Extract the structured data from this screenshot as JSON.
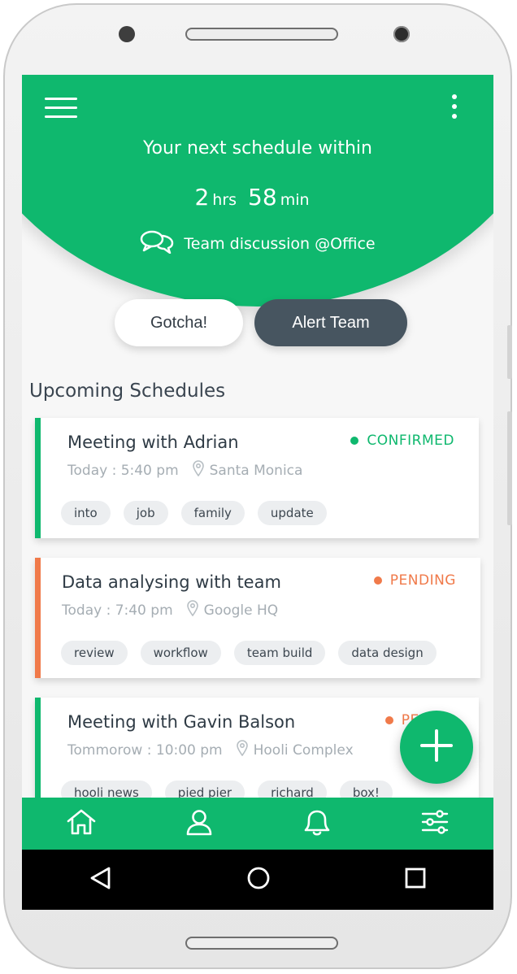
{
  "colors": {
    "accent": "#0fb86e",
    "pending": "#f07a4a",
    "dark_button": "#475560"
  },
  "header": {
    "title": "Your next schedule within",
    "hours_value": "2",
    "hours_unit": "hrs",
    "minutes_value": "58",
    "minutes_unit": "min",
    "event_text": "Team discussion @Office",
    "event_icon": "chat-bubbles-icon",
    "menu_icon": "hamburger-menu-icon",
    "more_icon": "kebab-more-icon"
  },
  "actions": {
    "gotcha_label": "Gotcha!",
    "alert_label": "Alert Team"
  },
  "section_title": "Upcoming Schedules",
  "schedules": [
    {
      "title": "Meeting with Adrian",
      "time": "Today : 5:40 pm",
      "location": "Santa Monica",
      "status": "CONFIRMED",
      "status_color": "#0fb86e",
      "tags": [
        "into",
        "job",
        "family",
        "update"
      ]
    },
    {
      "title": "Data analysing with team",
      "time": "Today : 7:40 pm",
      "location": "Google HQ",
      "status": "PENDING",
      "status_color": "#f07a4a",
      "tags": [
        "review",
        "workflow",
        "team build",
        "data design"
      ]
    },
    {
      "title": "Meeting with Gavin Balson",
      "time": "Tommorow : 10:00 pm",
      "location": "Hooli Complex",
      "status": "PEN",
      "status_color": "#f07a4a",
      "tags": [
        "hooli news",
        "pied pier",
        "richard",
        "box!"
      ]
    }
  ],
  "fab_icon": "plus-icon",
  "bottom_nav": [
    "home-icon",
    "profile-icon",
    "bell-icon",
    "sliders-icon"
  ],
  "system_nav": [
    "back-icon",
    "home-circle-icon",
    "recents-icon"
  ]
}
